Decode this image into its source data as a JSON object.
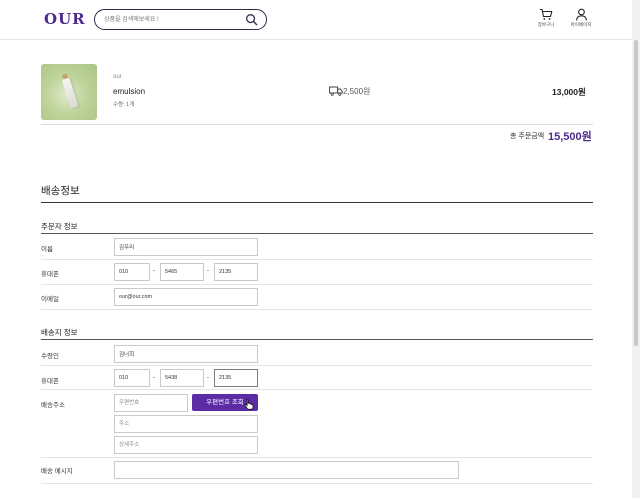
{
  "header": {
    "logo": "OUR",
    "search_placeholder": "상품을 검색해보세요 !",
    "cart_label": "장바구니",
    "mypage_label": "마이페이지"
  },
  "product": {
    "brand": "our",
    "name": "emulsion",
    "quantity": "수량: 1개",
    "shipping_fee": "2,500원",
    "price": "13,000원"
  },
  "total": {
    "label": "총 주문금액",
    "value": "15,500원"
  },
  "delivery": {
    "title": "배송정보",
    "orderer": {
      "title": "주문자 정보",
      "name_label": "이름",
      "name_value": "김우리",
      "phone_label": "휴대폰",
      "phone1": "010",
      "phone2": "5465",
      "phone3": "2135",
      "email_label": "이메일",
      "email_value": "our@our.com"
    },
    "recipient": {
      "title": "배송지 정보",
      "name_label": "수령인",
      "name_value": "김너희",
      "phone_label": "휴대폰",
      "phone1": "010",
      "phone2": "5438",
      "phone3": "2135",
      "address_label": "배송주소",
      "zipcode_placeholder": "우편번호",
      "zip_button": "우편번호 조회",
      "address_placeholder": "주소",
      "detail_placeholder": "상세주소",
      "message_label": "배송 메시지",
      "message_value": ""
    }
  },
  "colors": {
    "accent": "#5b2ca6",
    "logo": "#4b2a8c"
  }
}
